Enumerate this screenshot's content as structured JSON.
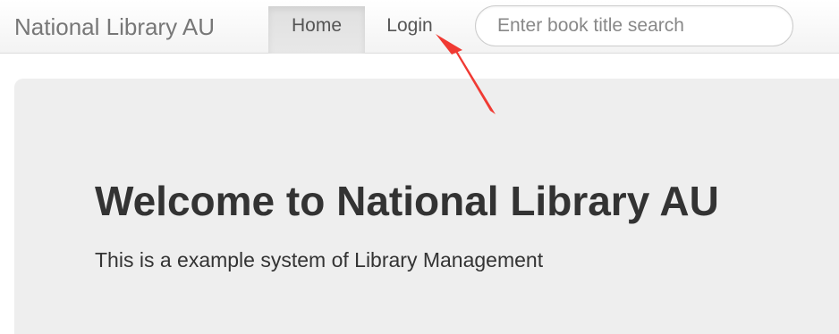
{
  "navbar": {
    "brand": "National Library AU",
    "links": [
      {
        "label": "Home",
        "active": true
      },
      {
        "label": "Login",
        "active": false
      }
    ],
    "search": {
      "placeholder": "Enter book title search",
      "value": ""
    }
  },
  "jumbotron": {
    "title": "Welcome to National Library AU",
    "text": "This is a example system of Library Management"
  },
  "annotation": {
    "arrow_color": "#f03a33",
    "target": "Login"
  },
  "colors": {
    "navbar_bg": "#f8f8f8",
    "active_link_bg": "#e7e7e7",
    "jumbotron_bg": "#eeeeee",
    "text": "#333333",
    "brand": "#777777"
  }
}
